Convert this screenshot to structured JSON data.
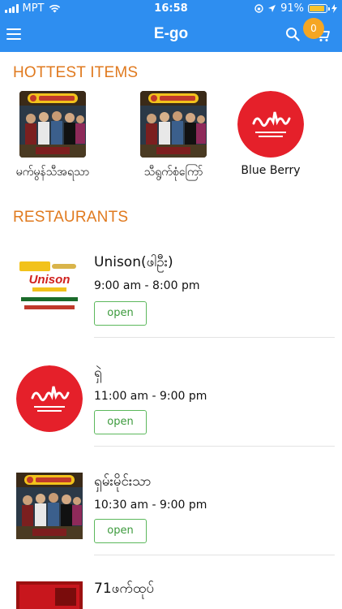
{
  "status_bar": {
    "carrier": "MPT",
    "time": "16:58",
    "battery": "91%",
    "battery_level": 0.91
  },
  "header": {
    "title": "E-go",
    "cart_count": "0"
  },
  "colors": {
    "header_blue": "#2e8ef0",
    "section_orange": "#e07a1f",
    "open_green": "#5cb85c",
    "badge_orange": "#f5a623",
    "logo_red": "#e5202a"
  },
  "hottest": {
    "title": "HOTTEST ITEMS",
    "items": [
      {
        "label": "မက်မွန်သီအရသာ",
        "thumb": "poster-thumb"
      },
      {
        "label": "သီရွက်စုံကြော်",
        "thumb": "poster-thumb"
      },
      {
        "label": "Blue Berry",
        "thumb": "red-logo-thumb"
      }
    ]
  },
  "restaurants": {
    "title": "RESTAURANTS",
    "items": [
      {
        "name": "Unison(ဖါဦး)",
        "hours": "9:00 am - 8:00 pm",
        "status": "open",
        "thumb": "unison-logo"
      },
      {
        "name": "ရှဲ",
        "hours": "11:00 am - 9:00 pm",
        "status": "open",
        "thumb": "red-logo-thumb"
      },
      {
        "name": "ရှမ်းမိုင်းသာ",
        "hours": "10:30 am - 9:00 pm",
        "status": "open",
        "thumb": "poster-thumb"
      },
      {
        "name": "71ဖက်ထုပ်",
        "hours": "",
        "status": "",
        "thumb": "restaurant-71-thumb"
      }
    ]
  },
  "thumb_text": {
    "unison_brand": "Unison"
  }
}
